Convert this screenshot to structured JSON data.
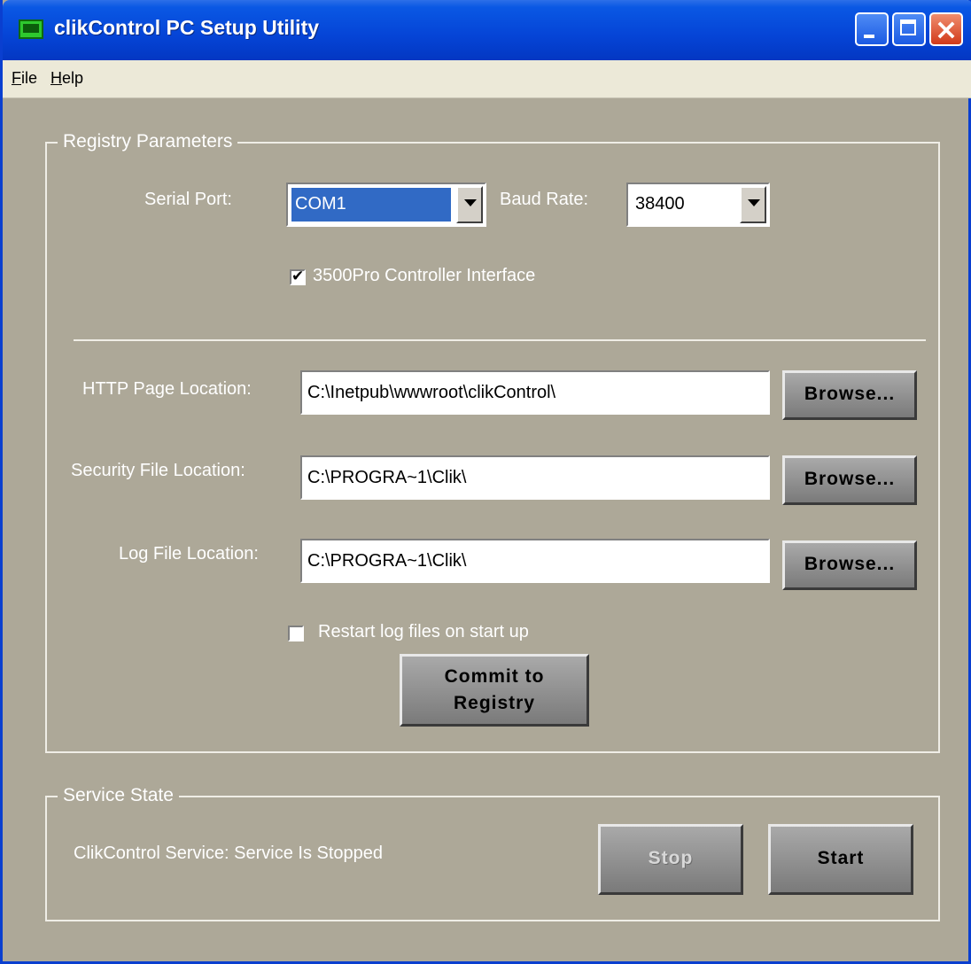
{
  "window": {
    "title": "clikControl PC Setup Utility",
    "icon": "app-icon"
  },
  "menu": [
    "File",
    "Help"
  ],
  "registry": {
    "group_label": "Registry Parameters",
    "serial_port_label": "Serial  Port:",
    "serial_port_value": "COM1",
    "baud_rate_label": "Baud Rate:",
    "baud_rate_value": "38400",
    "controller_checkbox_label": "3500Pro Controller Interface",
    "controller_checked": true,
    "http_label": "HTTP Page Location:",
    "http_value": "C:\\Inetpub\\wwwroot\\clikControl\\",
    "security_label": "Security File Location:",
    "security_value": "C:\\PROGRA~1\\Clik\\",
    "log_label": "Log File Location:",
    "log_value": "C:\\PROGRA~1\\Clik\\",
    "browse_label": "Browse...",
    "restart_label": "Restart log files on start up",
    "restart_checked": false,
    "commit_line1": "Commit to",
    "commit_line2": "Registry"
  },
  "service": {
    "group_label": "Service State",
    "status_text": "ClikControl Service: Service Is Stopped",
    "stop_label": "Stop",
    "start_label": "Start"
  }
}
